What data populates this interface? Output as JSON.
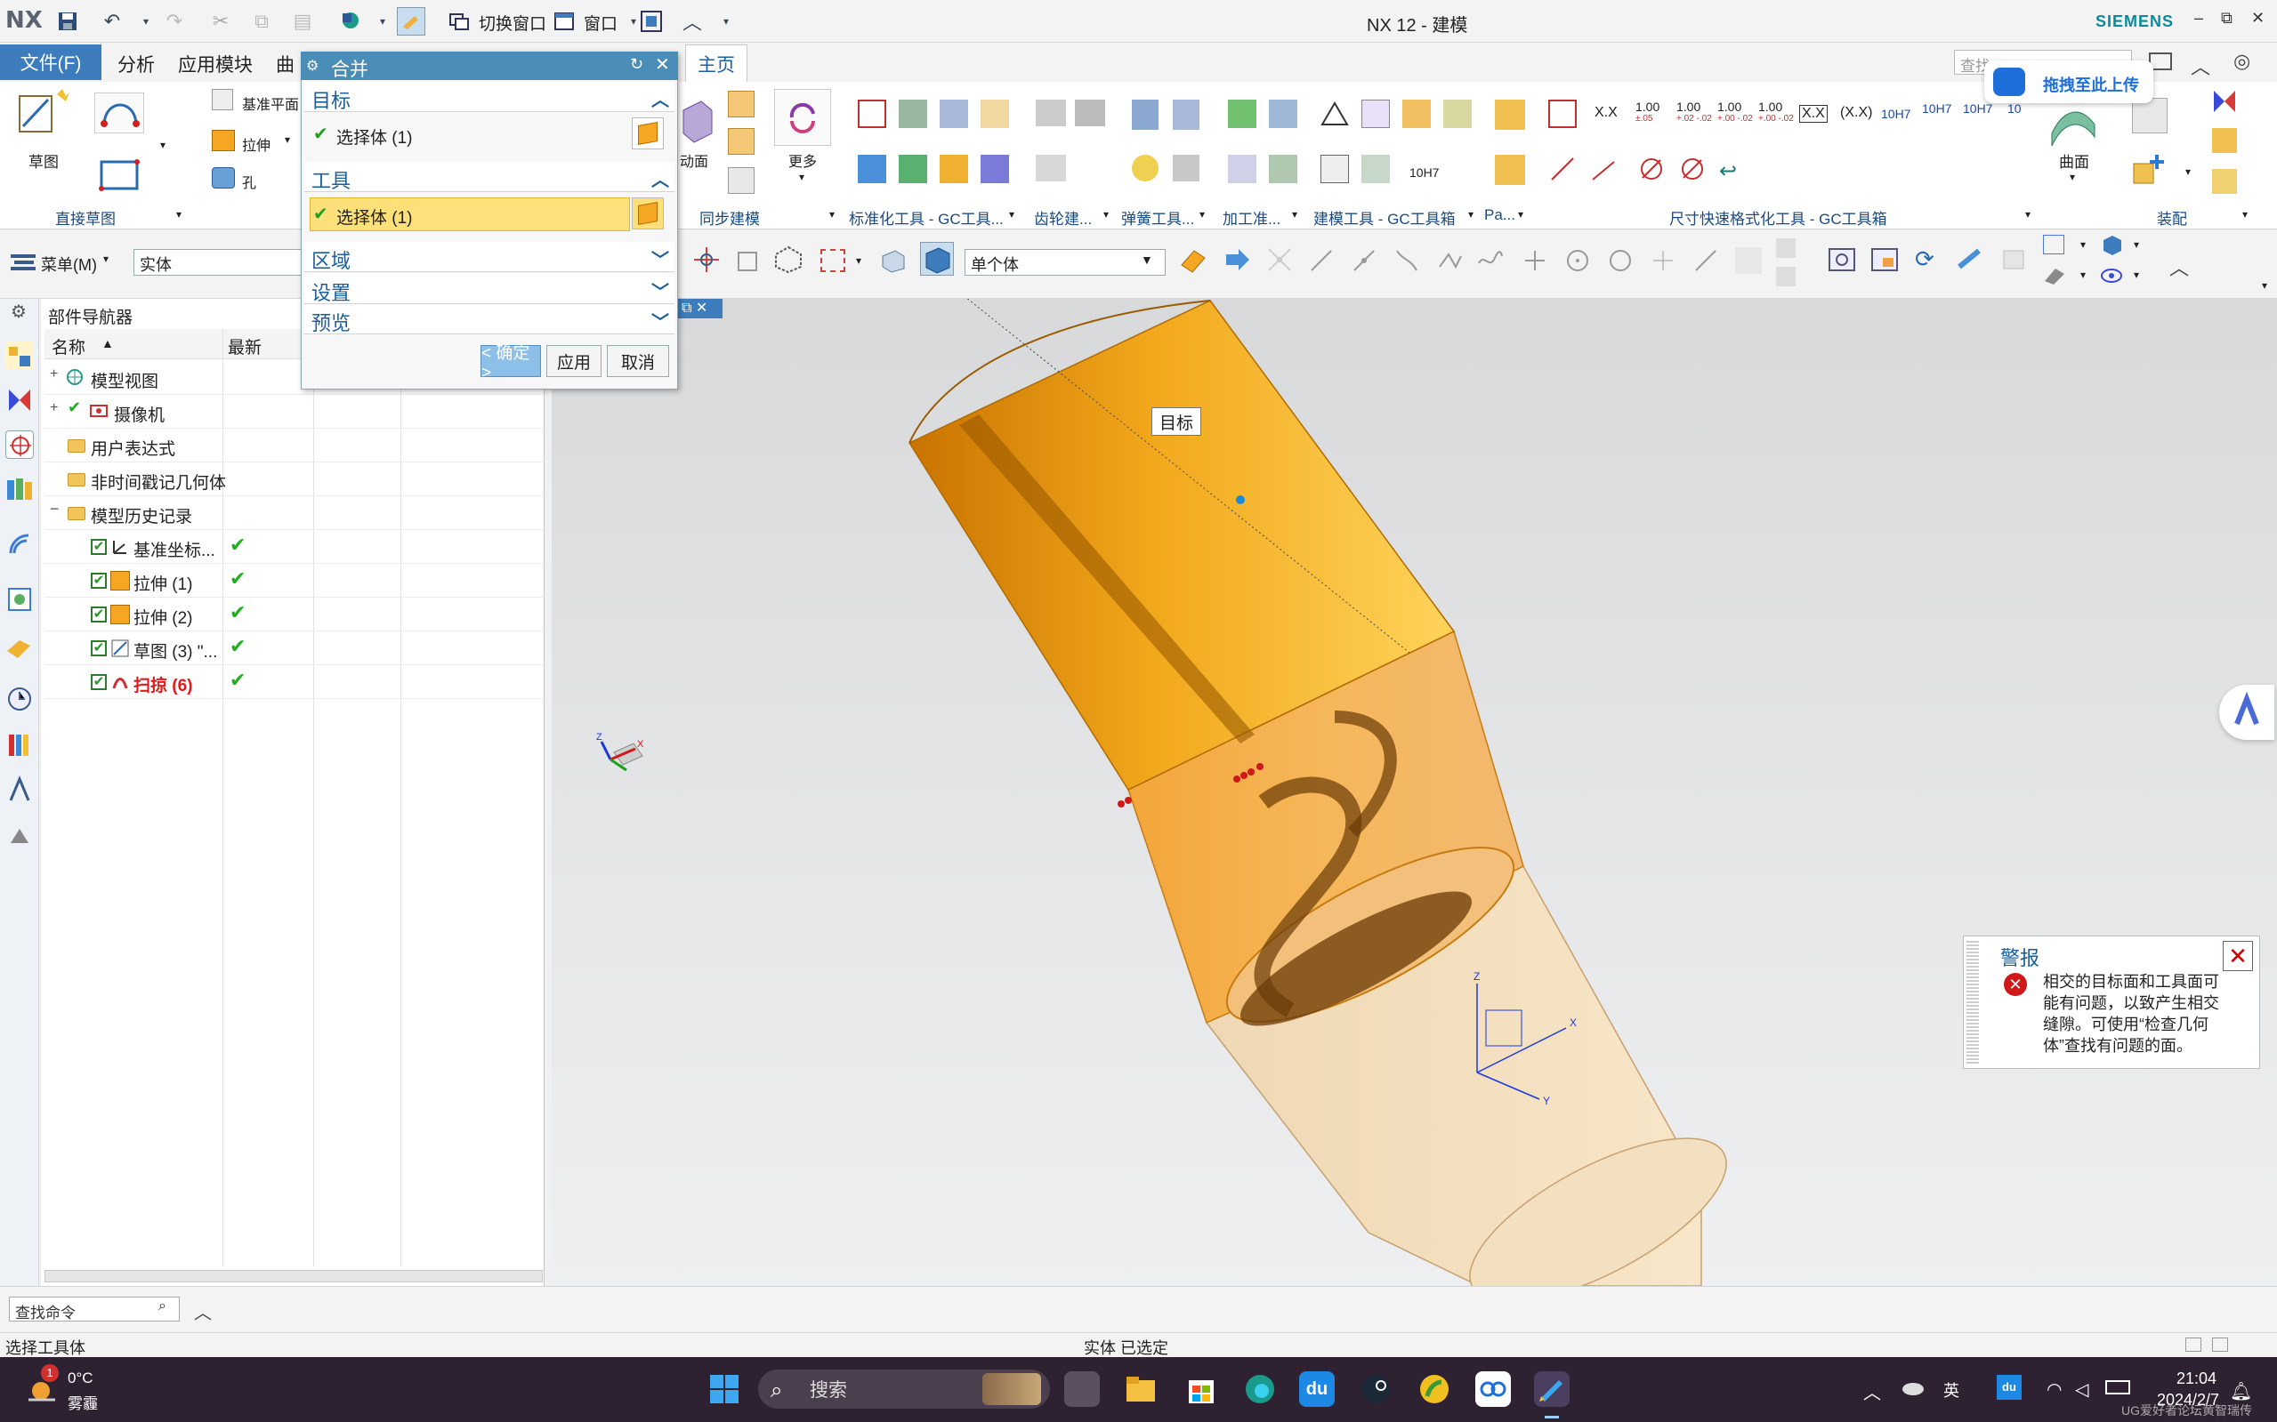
{
  "app": {
    "logo": "NX",
    "title": "NX 12 - 建模",
    "brand": "SIEMENS"
  },
  "quick_access": {
    "switch_window": "切换窗口",
    "window": "窗口"
  },
  "menu_tabs": [
    "文件(F)",
    "分析",
    "应用模块",
    "曲",
    "主页"
  ],
  "top_search_placeholder": "查找",
  "ribbon": {
    "sketch_label": "草图",
    "datum_plane": "基准平面",
    "extrude": "拉伸",
    "hole": "孔",
    "more": "更多",
    "surface": "曲面",
    "groups": [
      "直接草图",
      "同步建模",
      "标准化工具 - GC工具...",
      "齿轮建...",
      "弹簧工具...",
      "加工准...",
      "建模工具 - GC工具箱",
      "Pa...",
      "尺寸快速格式化工具 - GC工具箱",
      "装配"
    ],
    "dim_labels": [
      "X.X",
      "1.00",
      "1.00",
      "1.00",
      "1.00",
      "X.X",
      "(X.X)",
      "10H7",
      "10H7",
      "10H7",
      "10"
    ],
    "dim_tolerances": [
      "±.05",
      "+.02 -.02",
      "+.00 -.02",
      "+.00 -.02"
    ],
    "fit_label": "10H7"
  },
  "toolbar2": {
    "menu_button": "菜单(M)",
    "type_filter": "实体",
    "selection_scope": "单个体"
  },
  "navigator": {
    "title": "部件导航器",
    "columns": {
      "name": "名称",
      "latest": "最新"
    },
    "rows": [
      {
        "label": "模型视图",
        "latest": ""
      },
      {
        "label": "摄像机",
        "latest": ""
      },
      {
        "label": "用户表达式",
        "latest": ""
      },
      {
        "label": "非时间戳记几何体",
        "latest": ""
      },
      {
        "label": "模型历史记录",
        "latest": ""
      },
      {
        "label": "基准坐标...",
        "latest": "✔"
      },
      {
        "label": "拉伸 (1)",
        "latest": "✔"
      },
      {
        "label": "拉伸 (2)",
        "latest": "✔"
      },
      {
        "label": "草图 (3) \"...",
        "latest": "✔"
      },
      {
        "label": "扫掠 (6)",
        "latest": "✔"
      }
    ]
  },
  "dialog": {
    "title": "合并",
    "sections": {
      "target": "目标",
      "target_select": "选择体 (1)",
      "tool": "工具",
      "tool_select": "选择体 (1)",
      "region": "区域",
      "settings": "设置",
      "preview": "预览"
    },
    "buttons": {
      "ok": "< 确定 >",
      "apply": "应用",
      "cancel": "取消"
    }
  },
  "viewport": {
    "tag_label": "目标"
  },
  "alert": {
    "title": "警报",
    "message": "相交的目标面和工具面可能有问题，以致产生相交缝隙。可使用“检查几何体”查找有问题的面。"
  },
  "baidu": {
    "upload": "拖拽至此上传"
  },
  "cue": {
    "find_command": "查找命令"
  },
  "status": {
    "left": "选择工具体",
    "middle": "实体 已选定"
  },
  "taskbar": {
    "weather_temp": "0°C",
    "weather_cond": "雾霾",
    "weather_badge": "1",
    "search": "搜索",
    "ime": "英",
    "time": "21:04",
    "date": "2024/2/7"
  },
  "watermark": "UG爱好者论坛黄智瑞传",
  "colors": {
    "accent": "#3d7dbd",
    "dialog_header": "#4a8db6",
    "selected_row": "#fde07a",
    "part_orange": "#f5a623",
    "error_red": "#d01818",
    "taskbar": "#2e2232"
  }
}
